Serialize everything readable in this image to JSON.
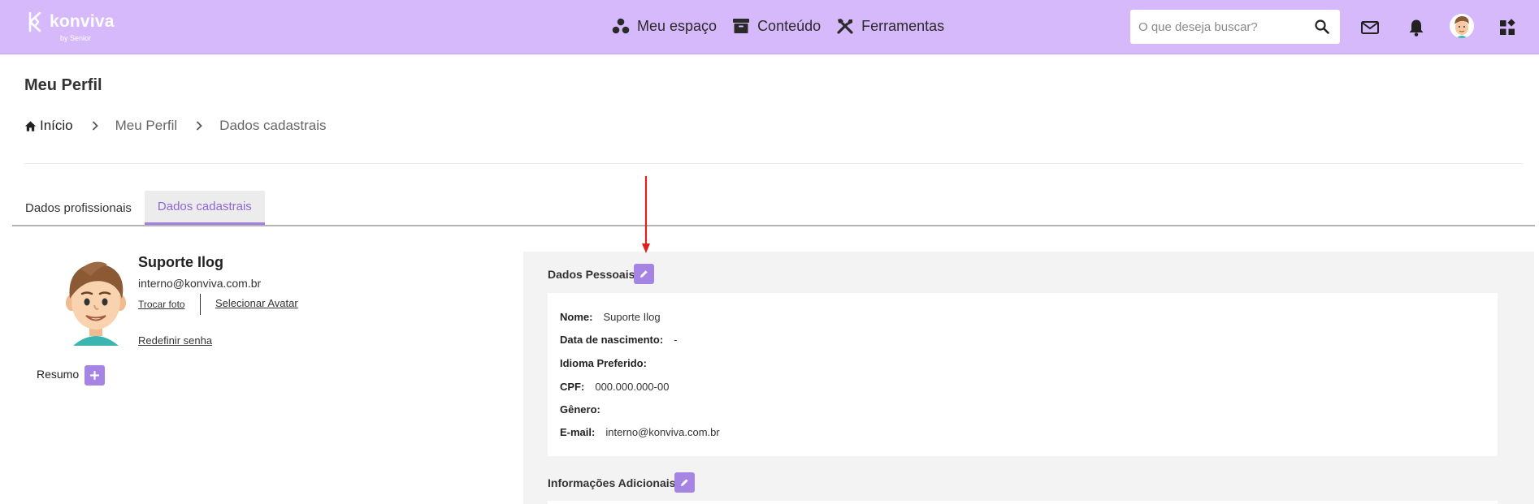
{
  "header": {
    "brand": "konviva",
    "brand_by": "by Senior",
    "nav": [
      {
        "label": "Meu espaço",
        "icon": "dots-group-icon"
      },
      {
        "label": "Conteúdo",
        "icon": "archive-box-icon"
      },
      {
        "label": "Ferramentas",
        "icon": "tools-icon"
      }
    ],
    "search": {
      "placeholder": "O que deseja buscar?",
      "value": ""
    },
    "icons": [
      "mail-icon",
      "bell-icon",
      "user-avatar",
      "widgets-icon"
    ]
  },
  "page": {
    "title": "Meu Perfil",
    "breadcrumb": [
      "Início",
      "Meu Perfil",
      "Dados cadastrais"
    ]
  },
  "tabs": [
    {
      "label": "Dados profissionais",
      "active": false
    },
    {
      "label": "Dados cadastrais",
      "active": true
    }
  ],
  "profile": {
    "name": "Suporte Ilog",
    "email": "interno@konviva.com.br",
    "change_photo": "Trocar foto",
    "select_avatar": "Selecionar Avatar",
    "reset_password": "Redefinir senha",
    "summary_label": "Resumo"
  },
  "personal": {
    "title": "Dados Pessoais",
    "fields": [
      {
        "label": "Nome:",
        "value": "Suporte Ilog"
      },
      {
        "label": "Data de nascimento:",
        "value": "-"
      },
      {
        "label": "Idioma Preferido:",
        "value": ""
      },
      {
        "label": "CPF:",
        "value": "000.000.000-00"
      },
      {
        "label": "Gênero:",
        "value": ""
      },
      {
        "label": "E-mail:",
        "value": "interno@konviva.com.br"
      }
    ]
  },
  "additional": {
    "title": "Informações Adicionais"
  },
  "colors": {
    "header_bg": "#d6b9fb",
    "accent": "#a584e3",
    "active_tab_text": "#8f66d6",
    "panel_bg": "#f3f3f3",
    "annotation_arrow": "#e02020"
  }
}
